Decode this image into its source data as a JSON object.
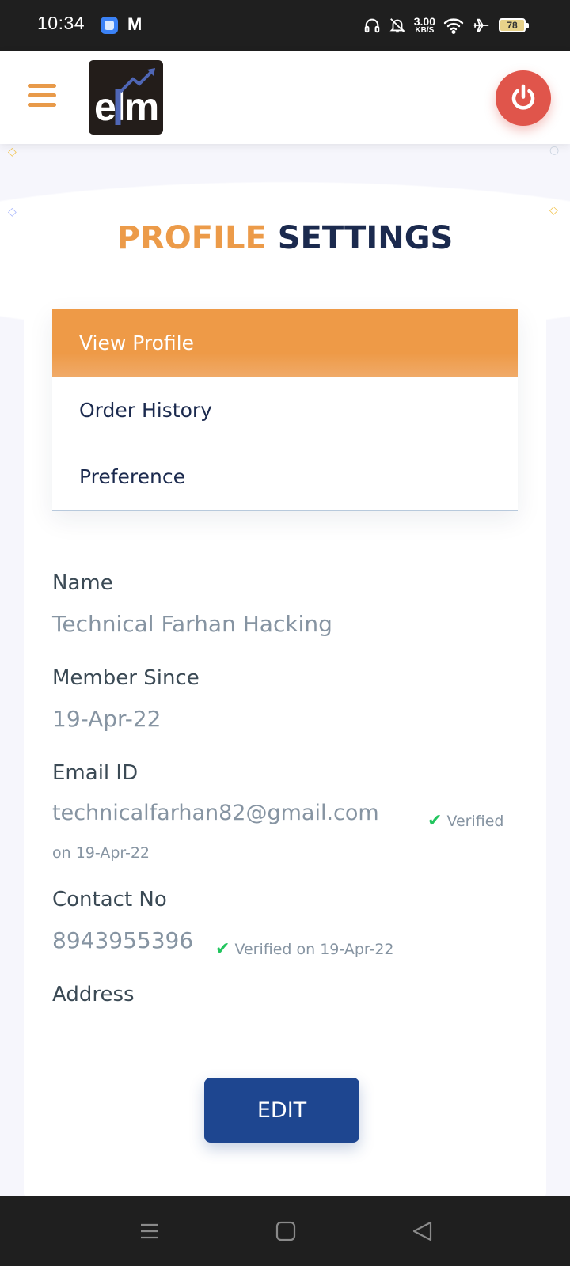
{
  "status_bar": {
    "time": "10:34",
    "net_speed_value": "3.00",
    "net_speed_unit": "KB/S",
    "battery": "78",
    "icons": [
      "app-icon",
      "gmail-icon",
      "headphones-icon",
      "bell-muted-icon",
      "wifi-icon",
      "airplane-icon",
      "battery-icon"
    ]
  },
  "header": {
    "logo_text": "elm",
    "menu_icon": "hamburger-icon",
    "power_icon": "power-icon"
  },
  "page": {
    "title_accent": "PROFILE",
    "title_main": "SETTINGS"
  },
  "menu": {
    "items": [
      {
        "label": "View Profile",
        "active": true
      },
      {
        "label": "Order History",
        "active": false
      },
      {
        "label": "Preference",
        "active": false
      }
    ]
  },
  "profile": {
    "name_label": "Name",
    "name_value": "Technical Farhan Hacking",
    "member_label": "Member Since",
    "member_value": "19-Apr-22",
    "email_label": "Email ID",
    "email_value": "technicalfarhan82@gmail.com",
    "email_verified_1": "Verified",
    "email_verified_2": "on 19-Apr-22",
    "contact_label": "Contact No",
    "contact_value": "8943955396",
    "contact_verified": "Verified on 19-Apr-22",
    "address_label": "Address"
  },
  "actions": {
    "edit_label": "EDIT"
  },
  "colors": {
    "accent": "#ec9b49",
    "navy": "#1b2a4e",
    "button": "#1e4690",
    "power": "#e0554b",
    "verified": "#22c55e"
  }
}
